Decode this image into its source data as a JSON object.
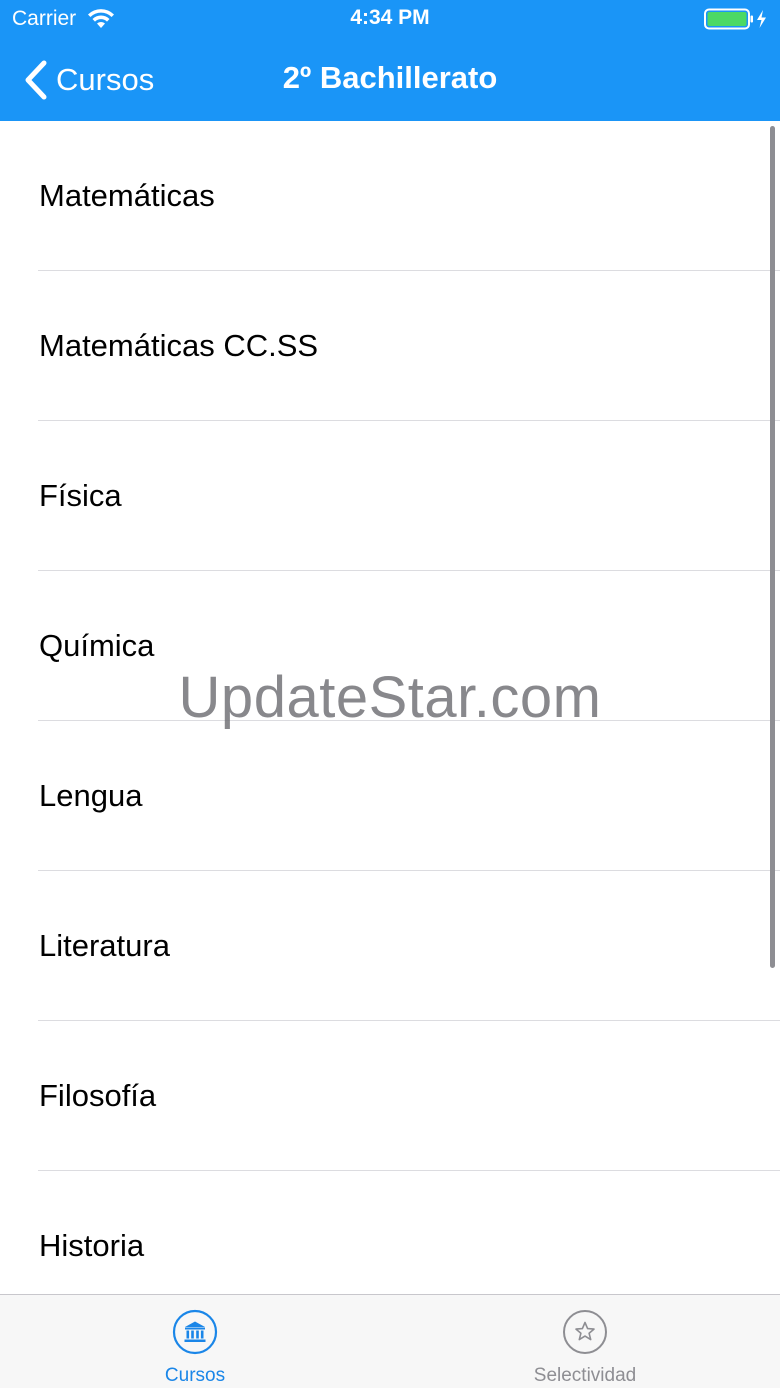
{
  "status_bar": {
    "carrier": "Carrier",
    "time": "4:34 PM",
    "wifi_icon": "wifi-icon",
    "battery_icon": "battery-charging-icon",
    "battery_color": "#4cd964"
  },
  "nav": {
    "back_label": "Cursos",
    "back_icon": "chevron-left-icon",
    "title": "2º Bachillerato",
    "bar_color": "#1a95f7"
  },
  "list": {
    "items": [
      {
        "label": "Matemáticas"
      },
      {
        "label": "Matemáticas CC.SS"
      },
      {
        "label": "Física"
      },
      {
        "label": "Química"
      },
      {
        "label": "Lengua"
      },
      {
        "label": "Literatura"
      },
      {
        "label": "Filosofía"
      },
      {
        "label": "Historia"
      }
    ]
  },
  "watermark": "UpdateStar.com",
  "tabbar": {
    "tabs": [
      {
        "label": "Cursos",
        "icon": "bank-icon",
        "selected": true,
        "color": "#1a86e8"
      },
      {
        "label": "Selectividad",
        "icon": "star-icon",
        "selected": false,
        "color": "#8e8e93"
      }
    ]
  }
}
